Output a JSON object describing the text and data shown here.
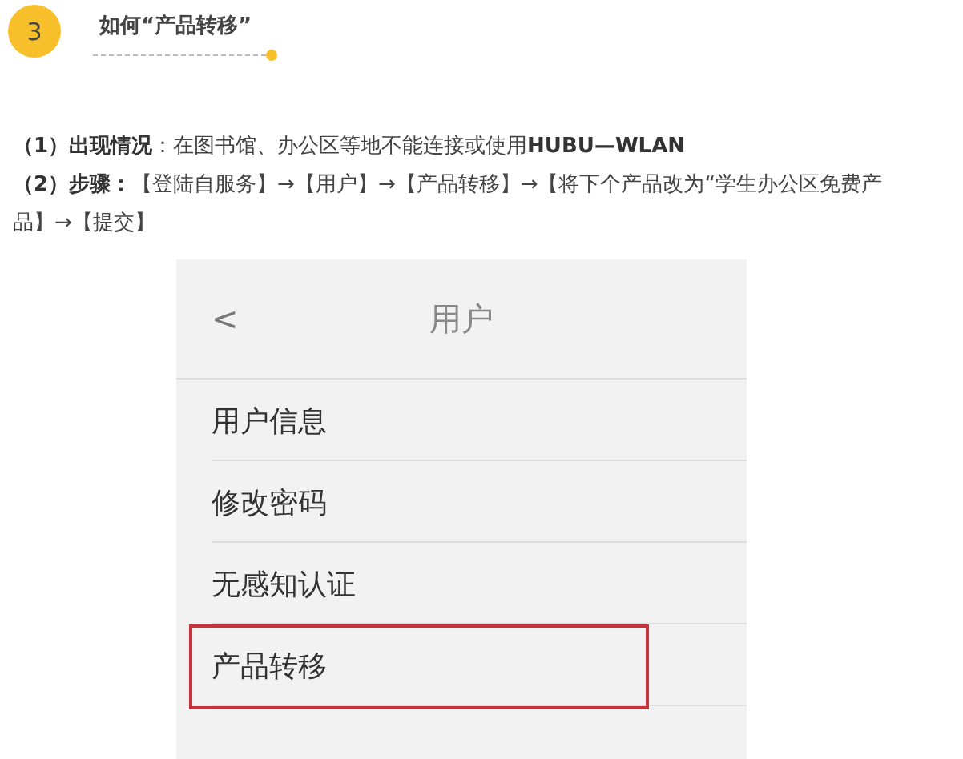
{
  "step": {
    "number": "3",
    "title": "如何“产品转移”"
  },
  "paragraphs": [
    "**（1）出现情况**：在图书馆、办公区等地不能连接或使用**HUBU—WLAN**",
    "**（2）步骤：**【登陆自服务】→【用户】→【产品转移】→【将下个产品改为“学生办公区免费产品】→【提交】"
  ],
  "phone": {
    "header": {
      "back": "<",
      "title": "用户"
    },
    "items": [
      {
        "label": "用户信息",
        "selected": false
      },
      {
        "label": "修改密码",
        "selected": false
      },
      {
        "label": "无感知认证",
        "selected": false
      },
      {
        "label": "产品转移",
        "selected": true
      }
    ]
  }
}
